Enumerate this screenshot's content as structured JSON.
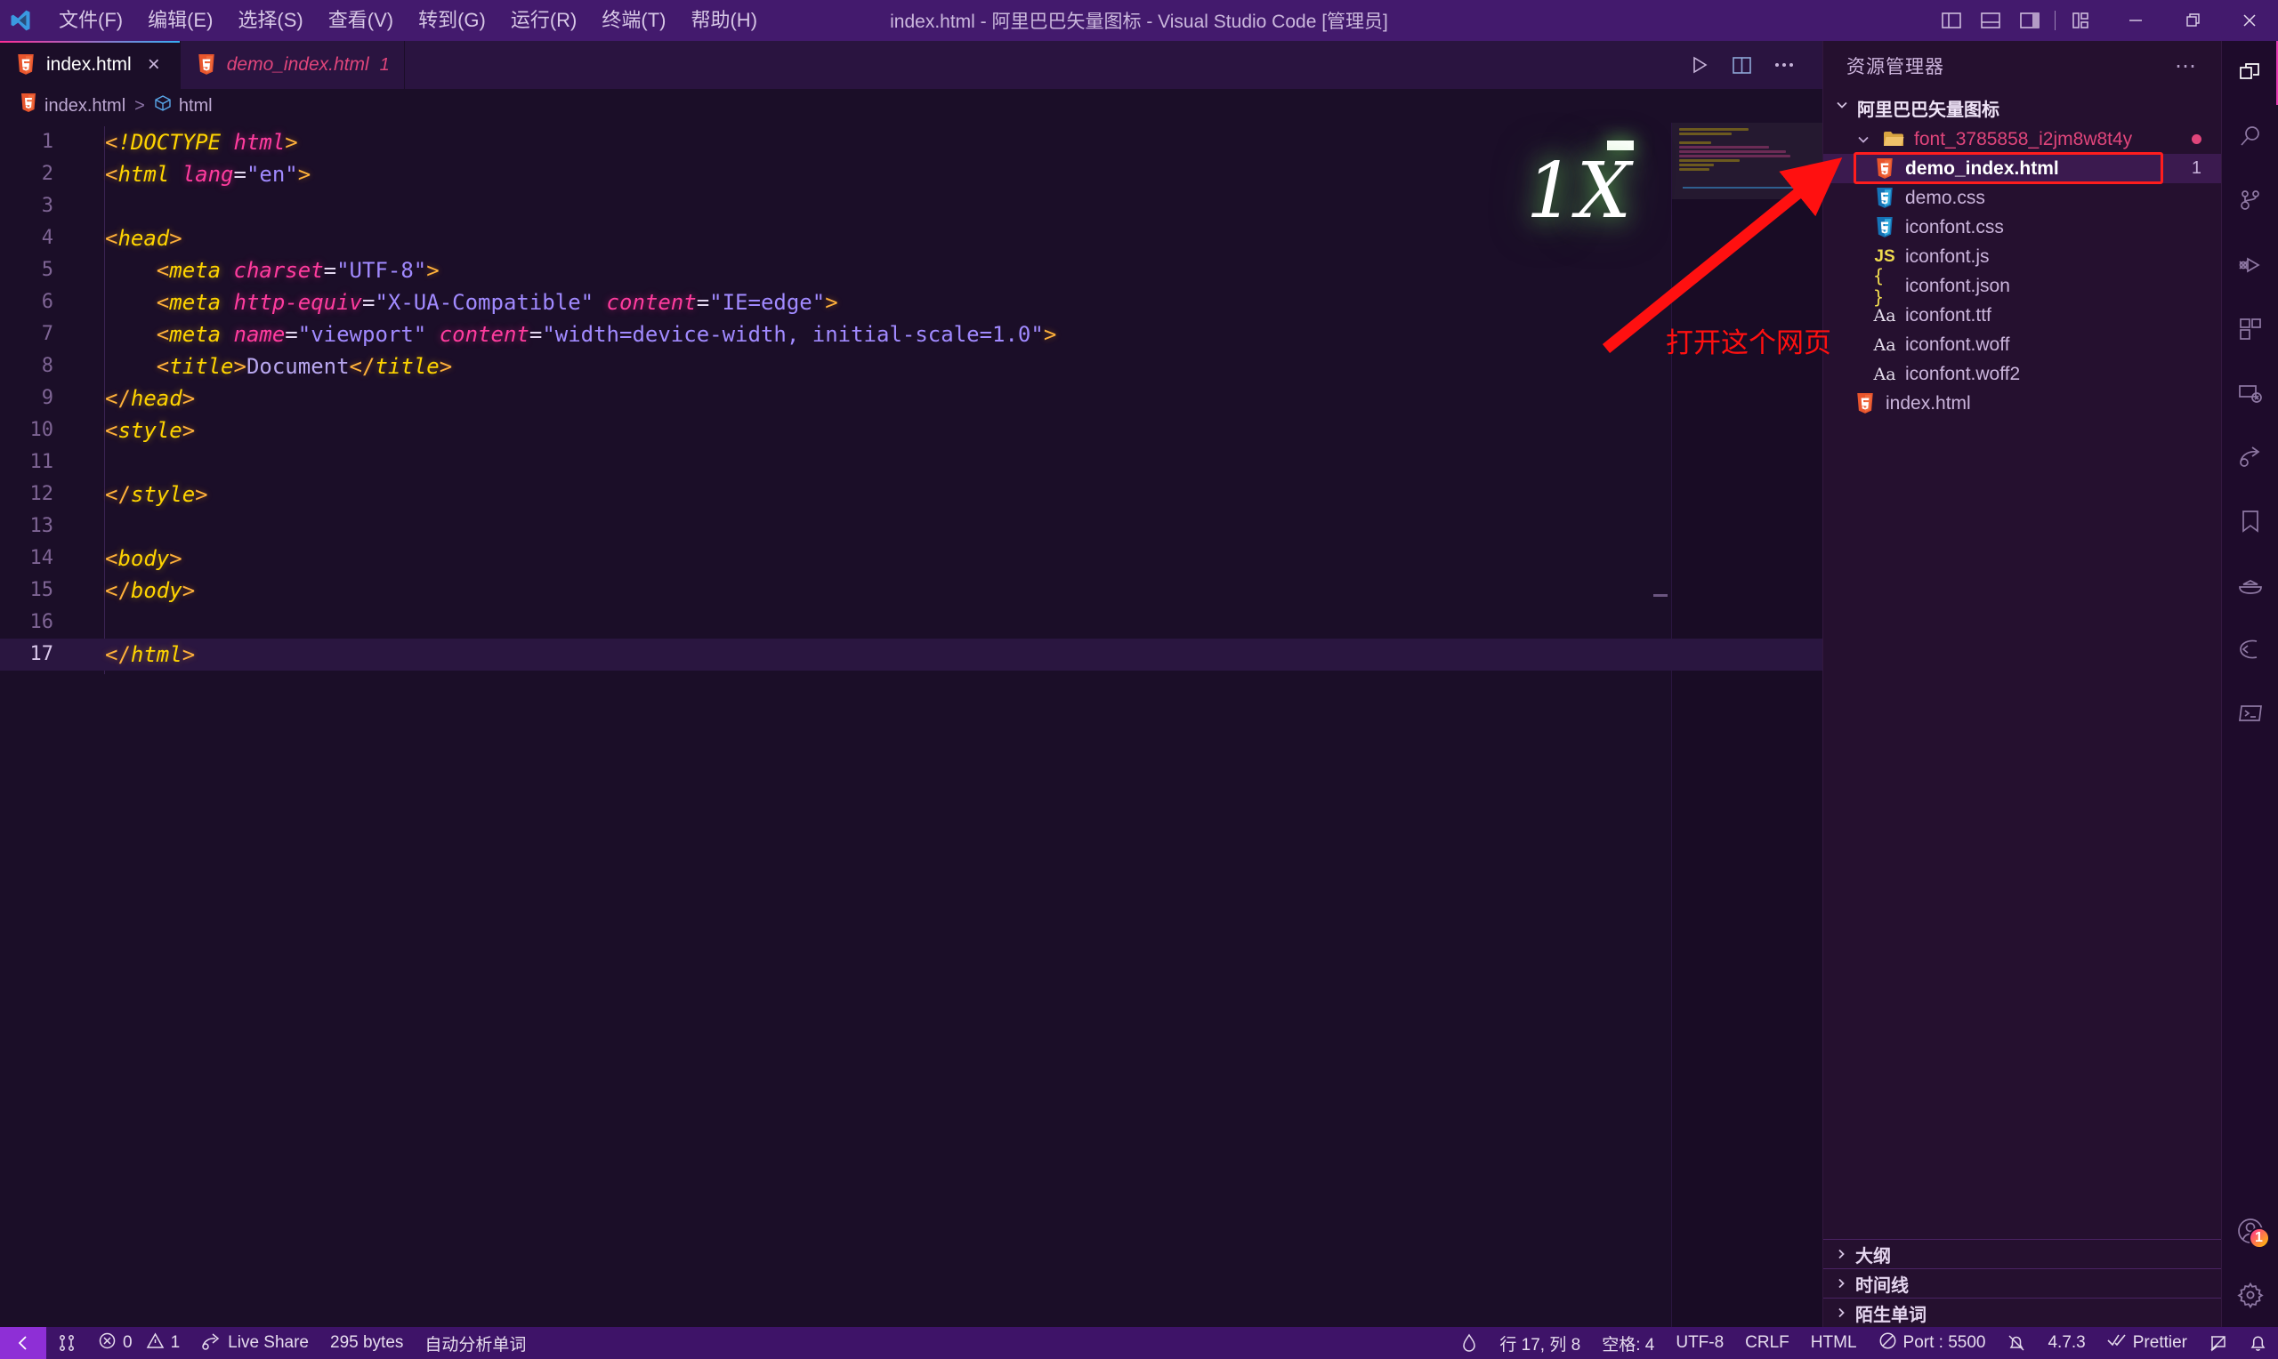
{
  "window": {
    "title": "index.html - 阿里巴巴矢量图标 - Visual Studio Code [管理员]",
    "logo_icon": "vscode-logo-icon",
    "minimize_icon": "minimize-icon",
    "maximize_icon": "maximize-icon",
    "close_icon": "close-icon",
    "layout_buttons": [
      {
        "name": "toggle-primary-sidebar-icon",
        "label": "切换主侧边栏"
      },
      {
        "name": "toggle-panel-icon",
        "label": "切换面板"
      },
      {
        "name": "toggle-secondary-sidebar-icon",
        "label": "切换辅助侧栏"
      },
      {
        "name": "customize-layout-icon",
        "label": "自定义布局"
      }
    ]
  },
  "menubar": {
    "items": [
      {
        "label": "文件(F)",
        "name": "menu-file"
      },
      {
        "label": "编辑(E)",
        "name": "menu-edit"
      },
      {
        "label": "选择(S)",
        "name": "menu-selection"
      },
      {
        "label": "查看(V)",
        "name": "menu-view"
      },
      {
        "label": "转到(G)",
        "name": "menu-go"
      },
      {
        "label": "运行(R)",
        "name": "menu-run"
      },
      {
        "label": "终端(T)",
        "name": "menu-terminal"
      },
      {
        "label": "帮助(H)",
        "name": "menu-help"
      }
    ]
  },
  "tabs": [
    {
      "label": "index.html",
      "icon": "html5-icon",
      "active": true,
      "dirty": false,
      "badge": "",
      "close": "×"
    },
    {
      "label": "demo_index.html",
      "icon": "html5-icon",
      "active": false,
      "dirty": true,
      "badge": "1",
      "close": ""
    }
  ],
  "editor_actions": [
    {
      "name": "run-code-button",
      "icon": "play-icon"
    },
    {
      "name": "split-editor-button",
      "icon": "split-editor-icon"
    },
    {
      "name": "more-actions-button",
      "icon": "ellipsis-icon"
    }
  ],
  "breadcrumb": {
    "file": "index.html",
    "separator": ">",
    "symbol": "html",
    "file_icon": "html5-icon",
    "symbol_icon": "cube-symbol-icon"
  },
  "code": {
    "language": "HTML",
    "current_line": 17,
    "lines": [
      {
        "n": 1,
        "tokens": [
          {
            "t": "brk",
            "v": "<"
          },
          {
            "t": "tag",
            "v": "!DOCTYPE"
          },
          {
            "t": "tag",
            "v": " "
          },
          {
            "t": "attr",
            "v": "html"
          },
          {
            "t": "brk",
            "v": ">"
          }
        ]
      },
      {
        "n": 2,
        "tokens": [
          {
            "t": "brk",
            "v": "<"
          },
          {
            "t": "tag",
            "v": "html"
          },
          {
            "t": "tag",
            "v": " "
          },
          {
            "t": "attr",
            "v": "lang"
          },
          {
            "t": "eq",
            "v": "="
          },
          {
            "t": "str",
            "v": "\"en\""
          },
          {
            "t": "brk",
            "v": ">"
          }
        ]
      },
      {
        "n": 3,
        "tokens": []
      },
      {
        "n": 4,
        "tokens": [
          {
            "t": "brk",
            "v": "<"
          },
          {
            "t": "tag",
            "v": "head"
          },
          {
            "t": "brk",
            "v": ">"
          }
        ]
      },
      {
        "n": 5,
        "tokens": [
          {
            "t": "plain",
            "v": "    "
          },
          {
            "t": "brk",
            "v": "<"
          },
          {
            "t": "tag",
            "v": "meta"
          },
          {
            "t": "tag",
            "v": " "
          },
          {
            "t": "attr",
            "v": "charset"
          },
          {
            "t": "eq",
            "v": "="
          },
          {
            "t": "str",
            "v": "\"UTF-8\""
          },
          {
            "t": "brk",
            "v": ">"
          }
        ]
      },
      {
        "n": 6,
        "tokens": [
          {
            "t": "plain",
            "v": "    "
          },
          {
            "t": "brk",
            "v": "<"
          },
          {
            "t": "tag",
            "v": "meta"
          },
          {
            "t": "tag",
            "v": " "
          },
          {
            "t": "attr",
            "v": "http-equiv"
          },
          {
            "t": "eq",
            "v": "="
          },
          {
            "t": "str",
            "v": "\"X-UA-Compatible\""
          },
          {
            "t": "tag",
            "v": " "
          },
          {
            "t": "attr",
            "v": "content"
          },
          {
            "t": "eq",
            "v": "="
          },
          {
            "t": "str",
            "v": "\"IE=edge\""
          },
          {
            "t": "brk",
            "v": ">"
          }
        ]
      },
      {
        "n": 7,
        "tokens": [
          {
            "t": "plain",
            "v": "    "
          },
          {
            "t": "brk",
            "v": "<"
          },
          {
            "t": "tag",
            "v": "meta"
          },
          {
            "t": "tag",
            "v": " "
          },
          {
            "t": "attr",
            "v": "name"
          },
          {
            "t": "eq",
            "v": "="
          },
          {
            "t": "str",
            "v": "\"viewport\""
          },
          {
            "t": "tag",
            "v": " "
          },
          {
            "t": "attr",
            "v": "content"
          },
          {
            "t": "eq",
            "v": "="
          },
          {
            "t": "str",
            "v": "\"width=device-width, initial-scale=1.0\""
          },
          {
            "t": "brk",
            "v": ">"
          }
        ]
      },
      {
        "n": 8,
        "tokens": [
          {
            "t": "plain",
            "v": "    "
          },
          {
            "t": "brk",
            "v": "<"
          },
          {
            "t": "tag",
            "v": "title"
          },
          {
            "t": "brk",
            "v": ">"
          },
          {
            "t": "txt",
            "v": "Document"
          },
          {
            "t": "brk",
            "v": "</"
          },
          {
            "t": "tag",
            "v": "title"
          },
          {
            "t": "brk",
            "v": ">"
          }
        ]
      },
      {
        "n": 9,
        "tokens": [
          {
            "t": "brk",
            "v": "</"
          },
          {
            "t": "tag",
            "v": "head"
          },
          {
            "t": "brk",
            "v": ">"
          }
        ]
      },
      {
        "n": 10,
        "tokens": [
          {
            "t": "brk",
            "v": "<"
          },
          {
            "t": "tag",
            "v": "style"
          },
          {
            "t": "brk",
            "v": ">"
          }
        ]
      },
      {
        "n": 11,
        "tokens": []
      },
      {
        "n": 12,
        "tokens": [
          {
            "t": "brk",
            "v": "</"
          },
          {
            "t": "tag",
            "v": "style"
          },
          {
            "t": "brk",
            "v": ">"
          }
        ]
      },
      {
        "n": 13,
        "tokens": []
      },
      {
        "n": 14,
        "tokens": [
          {
            "t": "brk",
            "v": "<"
          },
          {
            "t": "tag",
            "v": "body"
          },
          {
            "t": "brk",
            "v": ">"
          }
        ]
      },
      {
        "n": 15,
        "tokens": [
          {
            "t": "brk",
            "v": "</"
          },
          {
            "t": "tag",
            "v": "body"
          },
          {
            "t": "brk",
            "v": ">"
          }
        ]
      },
      {
        "n": 16,
        "tokens": []
      },
      {
        "n": 17,
        "tokens": [
          {
            "t": "brk",
            "v": "</"
          },
          {
            "t": "tag",
            "v": "html"
          },
          {
            "t": "brk",
            "v": ">"
          }
        ]
      }
    ]
  },
  "explorer": {
    "title": "资源管理器",
    "more_icon": "ellipsis-icon",
    "root": {
      "label": "阿里巴巴矢量图标",
      "twisty": "chevron-down-icon"
    },
    "tree": [
      {
        "label": "font_3785858_i2jm8w8t4y",
        "type": "folder",
        "icon": "folder-open-icon",
        "indent": 1,
        "twisty": "chevron-down-icon",
        "modified_dot": true,
        "count": ""
      },
      {
        "label": "demo_index.html",
        "type": "file",
        "icon": "html5-icon",
        "indent": 2,
        "selected": true,
        "highlight": true,
        "count": "1"
      },
      {
        "label": "demo.css",
        "type": "file",
        "icon": "css3-icon",
        "indent": 2,
        "count": ""
      },
      {
        "label": "iconfont.css",
        "type": "file",
        "icon": "css3-icon",
        "indent": 2,
        "count": ""
      },
      {
        "label": "iconfont.js",
        "type": "file",
        "icon": "js-icon",
        "indent": 2,
        "count": ""
      },
      {
        "label": "iconfont.json",
        "type": "file",
        "icon": "json-braces-icon",
        "indent": 2,
        "count": ""
      },
      {
        "label": "iconfont.ttf",
        "type": "file",
        "icon": "font-aa-icon",
        "indent": 2,
        "count": ""
      },
      {
        "label": "iconfont.woff",
        "type": "file",
        "icon": "font-aa-icon",
        "indent": 2,
        "count": ""
      },
      {
        "label": "iconfont.woff2",
        "type": "file",
        "icon": "font-aa-icon",
        "indent": 2,
        "count": ""
      },
      {
        "label": "index.html",
        "type": "file",
        "icon": "html5-icon",
        "indent": 1,
        "active_file": true,
        "count": ""
      }
    ],
    "sections": [
      {
        "label": "大纲",
        "twisty": "chevron-right-icon",
        "name": "outline-section"
      },
      {
        "label": "时间线",
        "twisty": "chevron-right-icon",
        "name": "timeline-section"
      },
      {
        "label": "陌生单词",
        "twisty": "chevron-right-icon",
        "name": "unfamiliar-words-section"
      }
    ]
  },
  "activitybar": {
    "items": [
      {
        "name": "explorer-icon",
        "active": true
      },
      {
        "name": "search-icon",
        "active": false
      },
      {
        "name": "source-control-icon",
        "active": false
      },
      {
        "name": "run-and-debug-icon",
        "active": false
      },
      {
        "name": "extensions-icon",
        "active": false
      },
      {
        "name": "remote-explorer-icon",
        "active": false
      },
      {
        "name": "live-share-icon",
        "active": false
      },
      {
        "name": "bookmarks-icon",
        "active": false
      },
      {
        "name": "docker-icon",
        "active": false
      },
      {
        "name": "import-cost-icon",
        "active": false
      },
      {
        "name": "terminal-panel-icon",
        "active": false
      }
    ],
    "bottom": [
      {
        "name": "accounts-icon",
        "badge": "1"
      },
      {
        "name": "manage-settings-gear-icon",
        "badge": ""
      }
    ]
  },
  "statusbar": {
    "left": [
      {
        "name": "remote-window-indicator",
        "label": "",
        "icon": "remote-icon"
      },
      {
        "name": "bookmark-toggle",
        "label": "",
        "icon": "bookmark-nav-icon"
      },
      {
        "name": "problems-indicator",
        "label": "0",
        "label2": "1",
        "icon": "error-icon",
        "icon2": "warning-icon"
      },
      {
        "name": "live-share-button",
        "label": "Live Share",
        "icon": "live-share-icon"
      },
      {
        "name": "file-size-indicator",
        "label": "295 bytes"
      },
      {
        "name": "auto-analyze-words-button",
        "label": "自动分析单词"
      }
    ],
    "right": [
      {
        "name": "color-picker-indicator",
        "label": "",
        "icon": "droplet-icon"
      },
      {
        "name": "cursor-position",
        "label": "行 17, 列 8"
      },
      {
        "name": "indentation",
        "label": "空格: 4"
      },
      {
        "name": "encoding",
        "label": "UTF-8"
      },
      {
        "name": "eol",
        "label": "CRLF"
      },
      {
        "name": "language-mode",
        "label": "HTML"
      },
      {
        "name": "live-server-port",
        "label": "Port : 5500",
        "icon": "circle-slash-icon"
      },
      {
        "name": "screencast-toggle",
        "label": "",
        "icon": "bell-slash-icon"
      },
      {
        "name": "version-indicator",
        "label": "4.7.3"
      },
      {
        "name": "prettier-indicator",
        "label": "Prettier",
        "icon": "check-check-icon"
      },
      {
        "name": "feedback-button",
        "label": "",
        "icon": "feedback-icon"
      },
      {
        "name": "notifications-bell",
        "label": "",
        "icon": "bell-icon"
      }
    ]
  },
  "annotations": {
    "watermark": "1X",
    "arrow_note": "打开这个网页",
    "arrow_color": "#ff1010",
    "highlight_color": "#ff1d1d"
  }
}
